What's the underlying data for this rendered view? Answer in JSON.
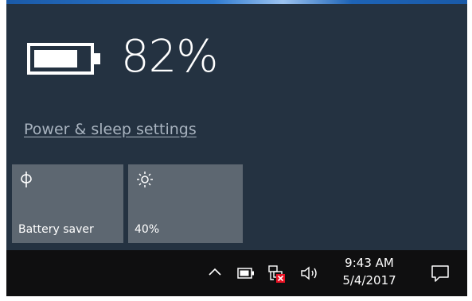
{
  "flyout": {
    "battery_percent": "82%",
    "battery_level": 0.82,
    "settings_link": "Power & sleep settings"
  },
  "quick_actions": [
    {
      "label": "Battery saver",
      "icon": "battery-saver-icon"
    },
    {
      "label": "40%",
      "icon": "brightness-icon"
    }
  ],
  "taskbar": {
    "time": "9:43 AM",
    "date": "5/4/2017",
    "icons": [
      "show-hidden-icons-chevron",
      "battery-icon",
      "network-disconnected-icon",
      "volume-icon",
      "action-center-icon"
    ]
  },
  "colors": {
    "flyout_bg": "#243241",
    "tile_bg": "#5d6771",
    "taskbar_bg": "#0f0f10",
    "accent": "#2f7bd0"
  }
}
